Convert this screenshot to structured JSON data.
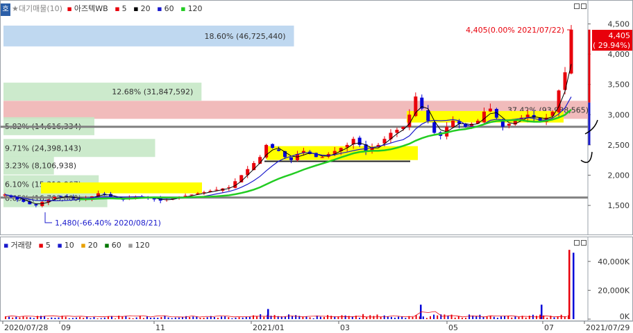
{
  "legend_price": {
    "title": "★대기매물(10)",
    "stock": "아즈텍WB",
    "ma5": "5",
    "ma20": "20",
    "ma60": "60",
    "ma120": "120"
  },
  "legend_volume": {
    "title": "거래량",
    "ma5": "5",
    "ma10": "10",
    "ma20": "20",
    "ma60": "60",
    "ma120": "120"
  },
  "home_tab": "호",
  "colors": {
    "up": "#e8000b",
    "down": "#0000d8",
    "ma5": "#000000",
    "ma20": "#e8000b",
    "ma60": "#1a1acc",
    "ma120": "#22cc22",
    "overhang_blue": "#b8d4ee",
    "overhang_green": "#c6e8c6",
    "overhang_pink": "#f0b4b4",
    "box_yellow": "#ffff00",
    "support_line": "#808080"
  },
  "annotations": {
    "high_label": "4,405(0.00% 2021/07/22)",
    "low_label": "1,480(-66.40% 2020/08/21)",
    "current_price": "4,405",
    "current_change": "( 29.94%)"
  },
  "chart_data": [
    {
      "type": "candlestick",
      "title": "아즈텍WB",
      "ylim": [
        1100,
        4700
      ],
      "y_ticks": [
        "4,500",
        "4,000",
        "3,500",
        "3,000",
        "2,500",
        "2,000",
        "1,500"
      ],
      "y_tick_values": [
        4500,
        4000,
        3500,
        3000,
        2500,
        2000,
        1500
      ],
      "overhang": [
        {
          "label": "18.60% (46,725,440)",
          "price": 4300,
          "pct": 18.6,
          "color": "blue"
        },
        {
          "label": "12.68% (31,847,592)",
          "price": 3380,
          "pct": 12.68,
          "color": "green"
        },
        {
          "label": "37.42% (93,988,565)",
          "price": 3080,
          "pct": 37.42,
          "color": "pink"
        },
        {
          "label": "5.82% (14,616,334)",
          "price": 2810,
          "pct": 5.82,
          "color": "green"
        },
        {
          "label": "9.71% (24,398,143)",
          "price": 2450,
          "pct": 9.71,
          "color": "green"
        },
        {
          "label": "3.23% (8,106,938)",
          "price": 2160,
          "pct": 3.23,
          "color": "green"
        },
        {
          "label": "6.10% (15,310,067)",
          "price": 1850,
          "pct": 6.1,
          "color": "green"
        },
        {
          "label": "6.65% (16,703,000)",
          "price": 1620,
          "pct": 6.65,
          "color": "green"
        }
      ],
      "support_lines": [
        2800,
        1630
      ],
      "x_labels": [
        "2020/07/28",
        "09",
        "11",
        "2021/01",
        "03",
        "05",
        "07",
        "2021/07/29"
      ],
      "close_series": [
        1680,
        1640,
        1600,
        1560,
        1520,
        1500,
        1560,
        1600,
        1640,
        1650,
        1640,
        1620,
        1600,
        1620,
        1650,
        1700,
        1680,
        1640,
        1620,
        1600,
        1620,
        1640,
        1650,
        1630,
        1600,
        1580,
        1600,
        1620,
        1640,
        1660,
        1680,
        1700,
        1720,
        1740,
        1760,
        1780,
        1800,
        1900,
        2000,
        2100,
        2200,
        2300,
        2500,
        2450,
        2400,
        2300,
        2250,
        2350,
        2400,
        2350,
        2300,
        2300,
        2350,
        2400,
        2450,
        2500,
        2600,
        2500,
        2400,
        2450,
        2500,
        2600,
        2700,
        2750,
        2800,
        3000,
        3300,
        3100,
        2900,
        2700,
        2650,
        2800,
        2900,
        2850,
        2800,
        2850,
        2900,
        3050,
        3100,
        2950,
        2800,
        2850,
        2900,
        2950,
        3000,
        2950,
        2900,
        2950,
        3050,
        3400,
        3700,
        4405
      ]
    },
    {
      "type": "bar",
      "title": "거래량",
      "y_ticks": [
        "40,000K",
        "20,000K",
        "0K"
      ],
      "y_tick_values": [
        40000,
        20000,
        0
      ],
      "unit": "K",
      "spikes": [
        {
          "date": "2021/01",
          "value": 7000
        },
        {
          "date": "2021/04",
          "value": 10000
        },
        {
          "date": "2021/07",
          "value": 10000
        },
        {
          "date": "2021/07/22",
          "value": 48000
        },
        {
          "date": "2021/07/23",
          "value": 46000
        }
      ]
    }
  ]
}
